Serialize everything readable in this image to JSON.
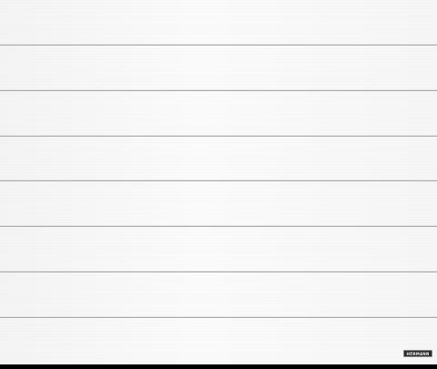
{
  "door": {
    "panel_color": "#f7f7f7",
    "groove_color": "#a9aab0",
    "panel_count": 8
  },
  "logo": {
    "text": "HÖRMANN"
  },
  "frame": {
    "bottom_color": "#000000"
  }
}
